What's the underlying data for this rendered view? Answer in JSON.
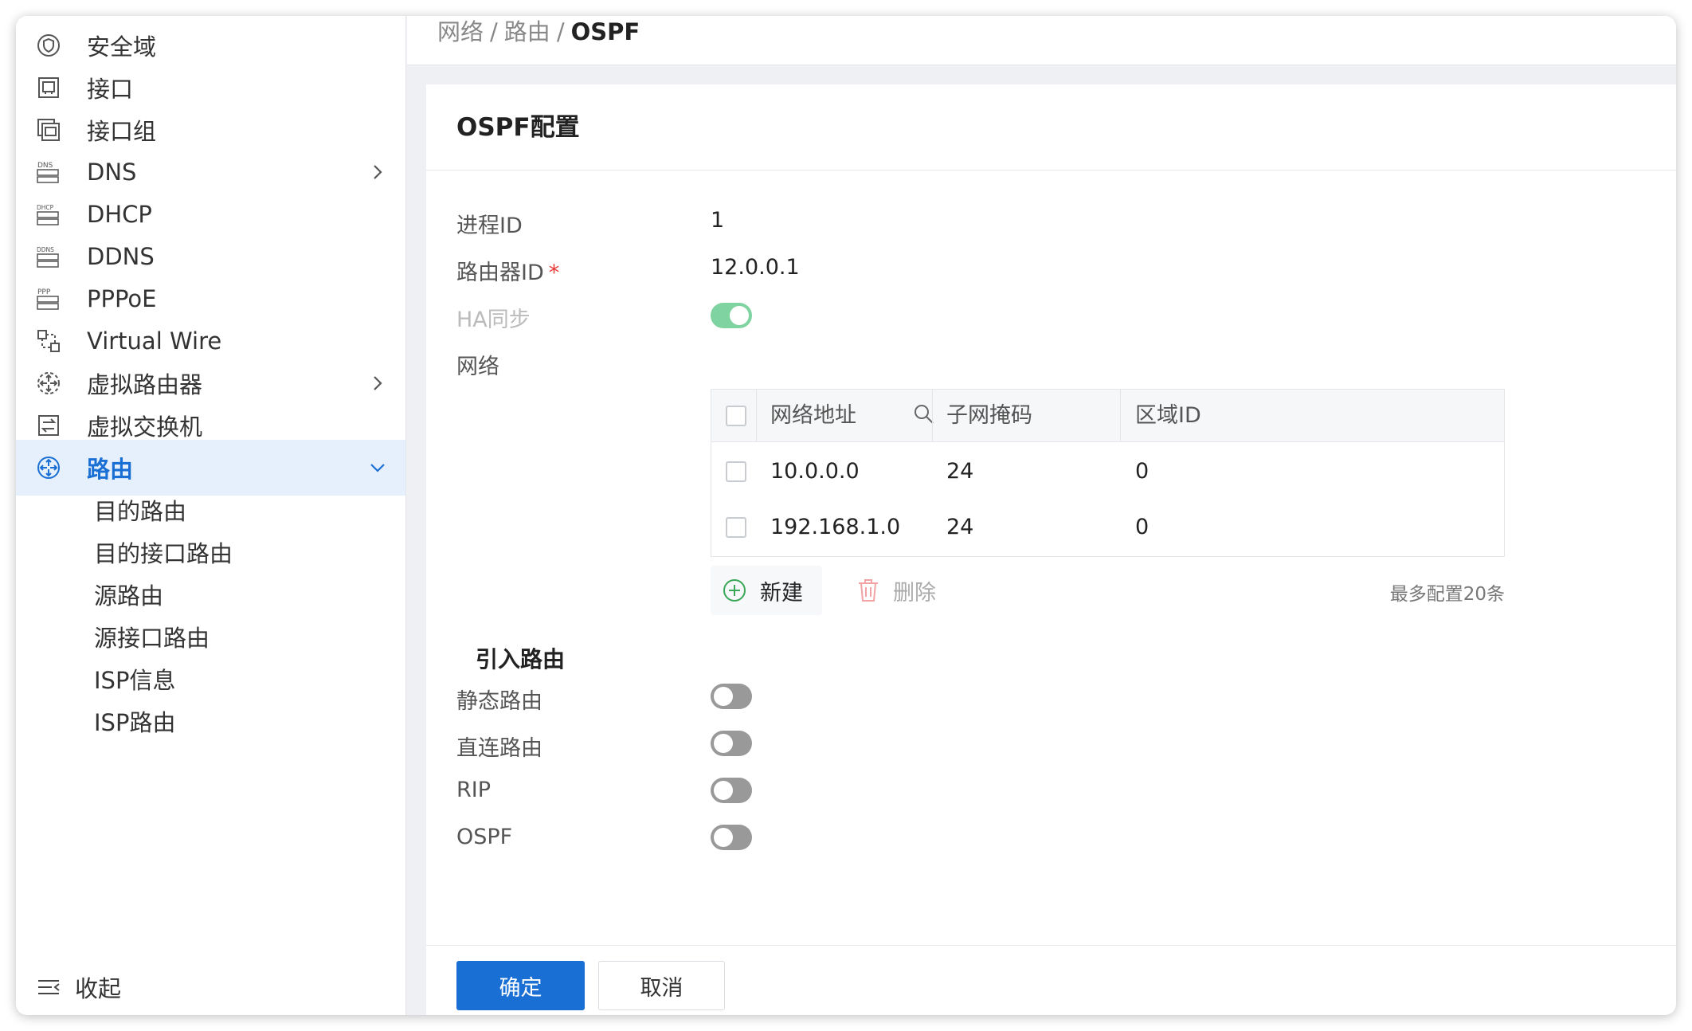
{
  "sidebar": {
    "items": [
      {
        "label": "安全域",
        "icon": "shield-icon"
      },
      {
        "label": "接口",
        "icon": "port-icon"
      },
      {
        "label": "接口组",
        "icon": "port-group-icon"
      },
      {
        "label": "DNS",
        "icon": "dns-icon",
        "has_children": true
      },
      {
        "label": "DHCP",
        "icon": "dhcp-icon"
      },
      {
        "label": "DDNS",
        "icon": "ddns-icon"
      },
      {
        "label": "PPPoE",
        "icon": "pppoe-icon"
      },
      {
        "label": "Virtual Wire",
        "icon": "virtual-wire-icon"
      },
      {
        "label": "虚拟路由器",
        "icon": "virtual-router-icon",
        "has_children": true
      },
      {
        "label": "虚拟交换机",
        "icon": "virtual-switch-icon"
      },
      {
        "label": "路由",
        "icon": "route-icon",
        "has_children": true,
        "expanded": true,
        "active": true
      }
    ],
    "route_children": [
      "目的路由",
      "目的接口路由",
      "源路由",
      "源接口路由",
      "ISP信息",
      "ISP路由"
    ],
    "collapse_label": "收起"
  },
  "breadcrumb": {
    "parts": [
      "网络",
      "路由"
    ],
    "current": "OSPF"
  },
  "panel": {
    "title": "OSPF配置",
    "process_id_label": "进程ID",
    "process_id_value": "1",
    "router_id_label": "路由器ID",
    "router_id_required": "*",
    "router_id_value": "12.0.0.1",
    "ha_sync_label": "HA同步",
    "ha_sync_on": true,
    "network_label": "网络",
    "table": {
      "columns": [
        "网络地址",
        "子网掩码",
        "区域ID"
      ],
      "rows": [
        {
          "address": "10.0.0.0",
          "mask": "24",
          "area": "0"
        },
        {
          "address": "192.168.1.0",
          "mask": "24",
          "area": "0"
        }
      ]
    },
    "new_label": "新建",
    "delete_label": "删除",
    "max_note": "最多配置20条",
    "redistribute_title": "引入路由",
    "redistribute": [
      {
        "label": "静态路由",
        "on": false
      },
      {
        "label": "直连路由",
        "on": false
      },
      {
        "label": "RIP",
        "on": false
      },
      {
        "label": "OSPF",
        "on": false
      }
    ],
    "confirm_label": "确定",
    "cancel_label": "取消"
  },
  "colors": {
    "accent": "#1a6fd4",
    "active_bg": "#e6f0fc",
    "toggle_on": "#7fd3a0",
    "add_green": "#3aa757"
  }
}
